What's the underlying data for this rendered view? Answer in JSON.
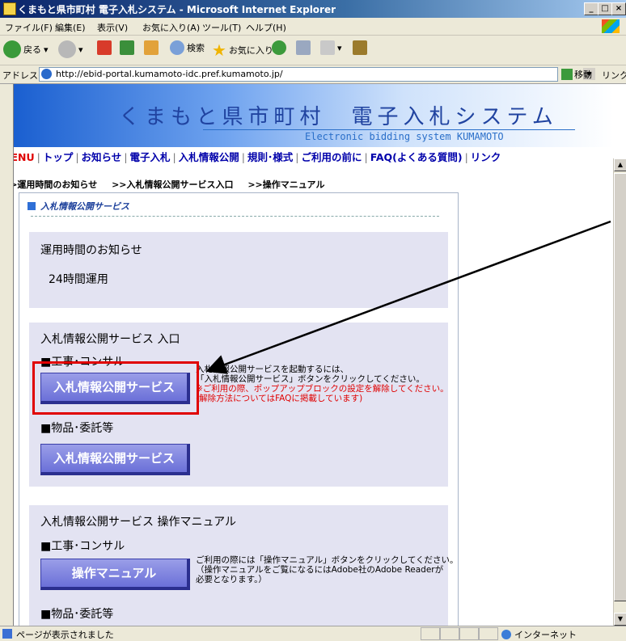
{
  "window": {
    "title": "くまもと県市町村 電子入札システム - Microsoft Internet Explorer",
    "controls": [
      "_",
      "□",
      "×"
    ]
  },
  "menubar": {
    "items": [
      "ファイル(F)",
      "編集(E)",
      "表示(V)",
      "お気に入り(A)",
      "ツール(T)",
      "ヘルプ(H)"
    ]
  },
  "toolbar": {
    "back": "戻る",
    "search": "検索",
    "favorites": "お気に入り"
  },
  "address": {
    "label": "アドレス(D)",
    "url": "http://ebid-portal.kumamoto-idc.pref.kumamoto.jp/",
    "go": "移動",
    "links": "リンク »"
  },
  "site": {
    "title": "くまもと県市町村　電子入札システム",
    "subtitle": "Electronic bidding system KUMAMOTO",
    "nav": {
      "menu": "MENU",
      "items": [
        "トップ",
        "お知らせ",
        "電子入札",
        "入札情報公開",
        "規則･様式",
        "ご利用の前に",
        "FAQ(よくある質問)",
        "リンク"
      ]
    },
    "quicklinks": [
      ">>運用時間のお知らせ",
      ">>入札情報公開サービス入口",
      ">>操作マニュアル"
    ]
  },
  "service": {
    "heading": "入札情報公開サービス",
    "hours": {
      "title": "運用時間のお知らせ",
      "value": "24時間運用"
    },
    "entry": {
      "title": "入札情報公開サービス 入口",
      "construction_label": "■工事･コンサル",
      "button": "入札情報公開サービス",
      "note_line1": "入札情報公開サービスを起動するには、",
      "note_line2": "「入札情報公開サービス」ボタンをクリックしてください。",
      "note_warn1": "※ご利用の際、ポップアップブロックの設定を解除してください。",
      "note_warn2": "(解除方法についてはFAQに掲載しています)",
      "goods_label": "■物品･委託等",
      "button2": "入札情報公開サービス"
    },
    "manual": {
      "title": "入札情報公開サービス 操作マニュアル",
      "construction_label": "■工事･コンサル",
      "button": "操作マニュアル",
      "note_line1": "ご利用の際には「操作マニュアル」ボタンをクリックしてください。",
      "note_line2": "（操作マニュアルをご覧になるにはAdobe社のAdobe Readerが",
      "note_line3": "必要となります。）",
      "goods_label": "■物品･委託等"
    }
  },
  "status": {
    "text": "ページが表示されました",
    "zone": "インターネット"
  },
  "colors": {
    "highlight": "#e00000",
    "button": "#6b70d8",
    "panel": "#e3e3f2",
    "nav_link": "#0000aa"
  }
}
